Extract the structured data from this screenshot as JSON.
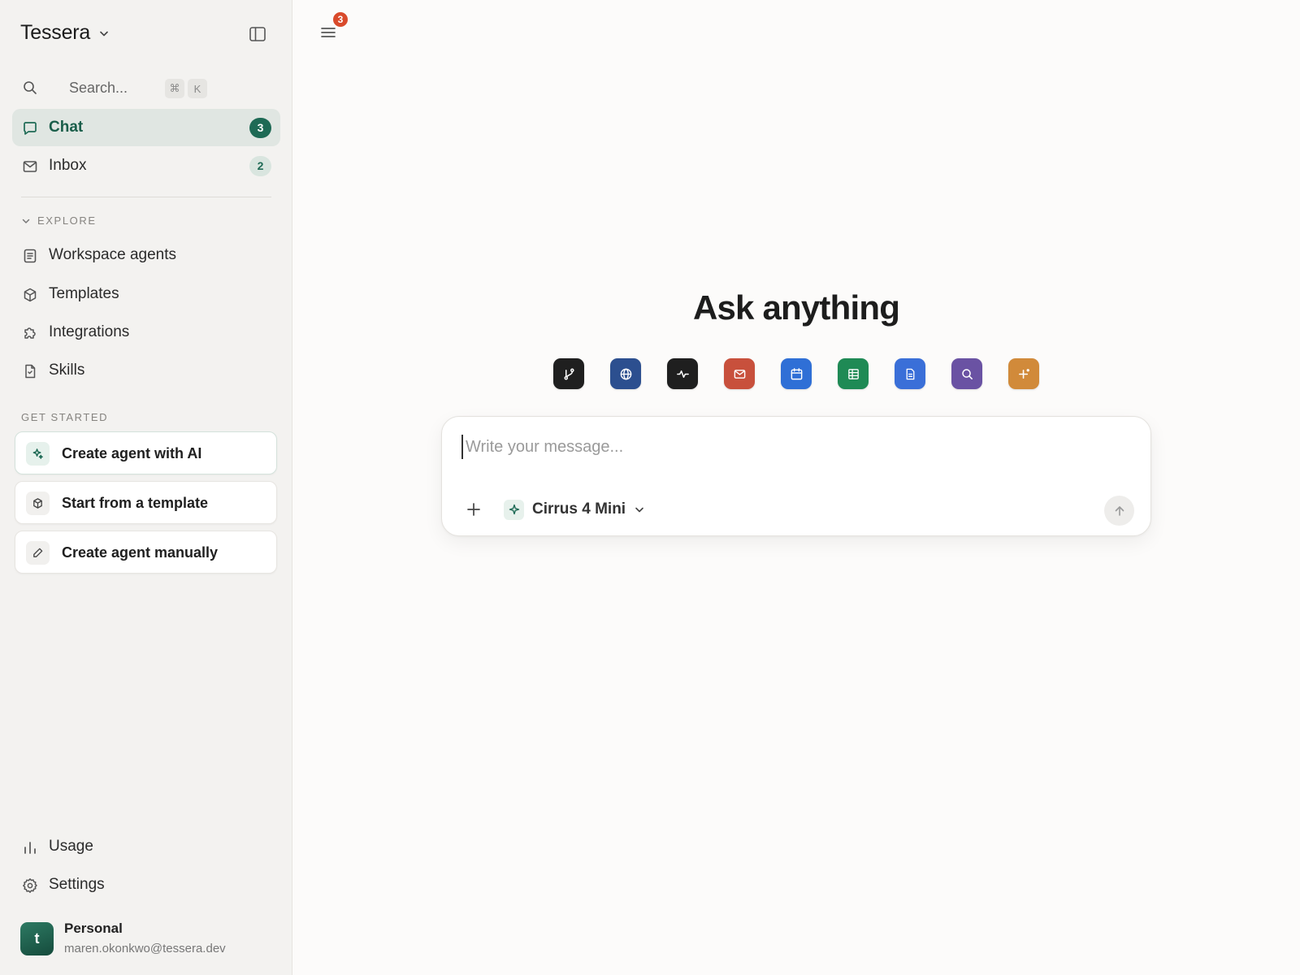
{
  "app": {
    "name": "Tessera"
  },
  "search": {
    "placeholder": "Search...",
    "shortcut_mod": "⌘",
    "shortcut_key": "K"
  },
  "nav": {
    "items": [
      {
        "label": "Chat",
        "count": "3",
        "icon": "chat-bubble-icon",
        "active": true
      },
      {
        "label": "Inbox",
        "count": "2",
        "icon": "mail-icon",
        "active": false
      }
    ]
  },
  "explore": {
    "heading": "EXPLORE",
    "items": [
      {
        "label": "Workspace agents",
        "icon": "document-list-icon"
      },
      {
        "label": "Templates",
        "icon": "cube-icon"
      },
      {
        "label": "Integrations",
        "icon": "puzzle-icon"
      },
      {
        "label": "Skills",
        "icon": "file-icon"
      }
    ]
  },
  "get_started": {
    "heading": "GET STARTED",
    "items": [
      {
        "label": "Create agent with AI",
        "icon": "sparkle-icon"
      },
      {
        "label": "Start from a template",
        "icon": "cube-icon"
      },
      {
        "label": "Create agent manually",
        "icon": "pencil-icon"
      }
    ]
  },
  "footer_nav": {
    "items": [
      {
        "label": "Usage",
        "icon": "bar-chart-icon"
      },
      {
        "label": "Settings",
        "icon": "gear-icon"
      }
    ]
  },
  "profile": {
    "initial": "t",
    "name": "Personal",
    "email": "maren.okonkwo@tessera.dev"
  },
  "header": {
    "notification_count": "3"
  },
  "main": {
    "title": "Ask anything",
    "tools": [
      {
        "icon": "git-branch-icon",
        "color": "#1f1f1f"
      },
      {
        "icon": "globe-icon",
        "color": "#2c4f8f"
      },
      {
        "icon": "activity-icon",
        "color": "#1f1f1f"
      },
      {
        "icon": "mail-icon",
        "color": "#c8503c"
      },
      {
        "icon": "calendar-icon",
        "color": "#2f6fd6"
      },
      {
        "icon": "table-icon",
        "color": "#1f8a55"
      },
      {
        "icon": "document-icon",
        "color": "#3a6fd8"
      },
      {
        "icon": "search-icon",
        "color": "#6a52a3"
      },
      {
        "icon": "plus-sparkle-icon",
        "color": "#d18a3a"
      }
    ]
  },
  "composer": {
    "placeholder": "Write your message...",
    "model": "Cirrus 4 Mini"
  },
  "colors": {
    "accent": "#1e6a55",
    "sidebar_bg": "#f3f2f0",
    "active_bg": "#e0e6e2",
    "notification": "#d94a2b"
  }
}
